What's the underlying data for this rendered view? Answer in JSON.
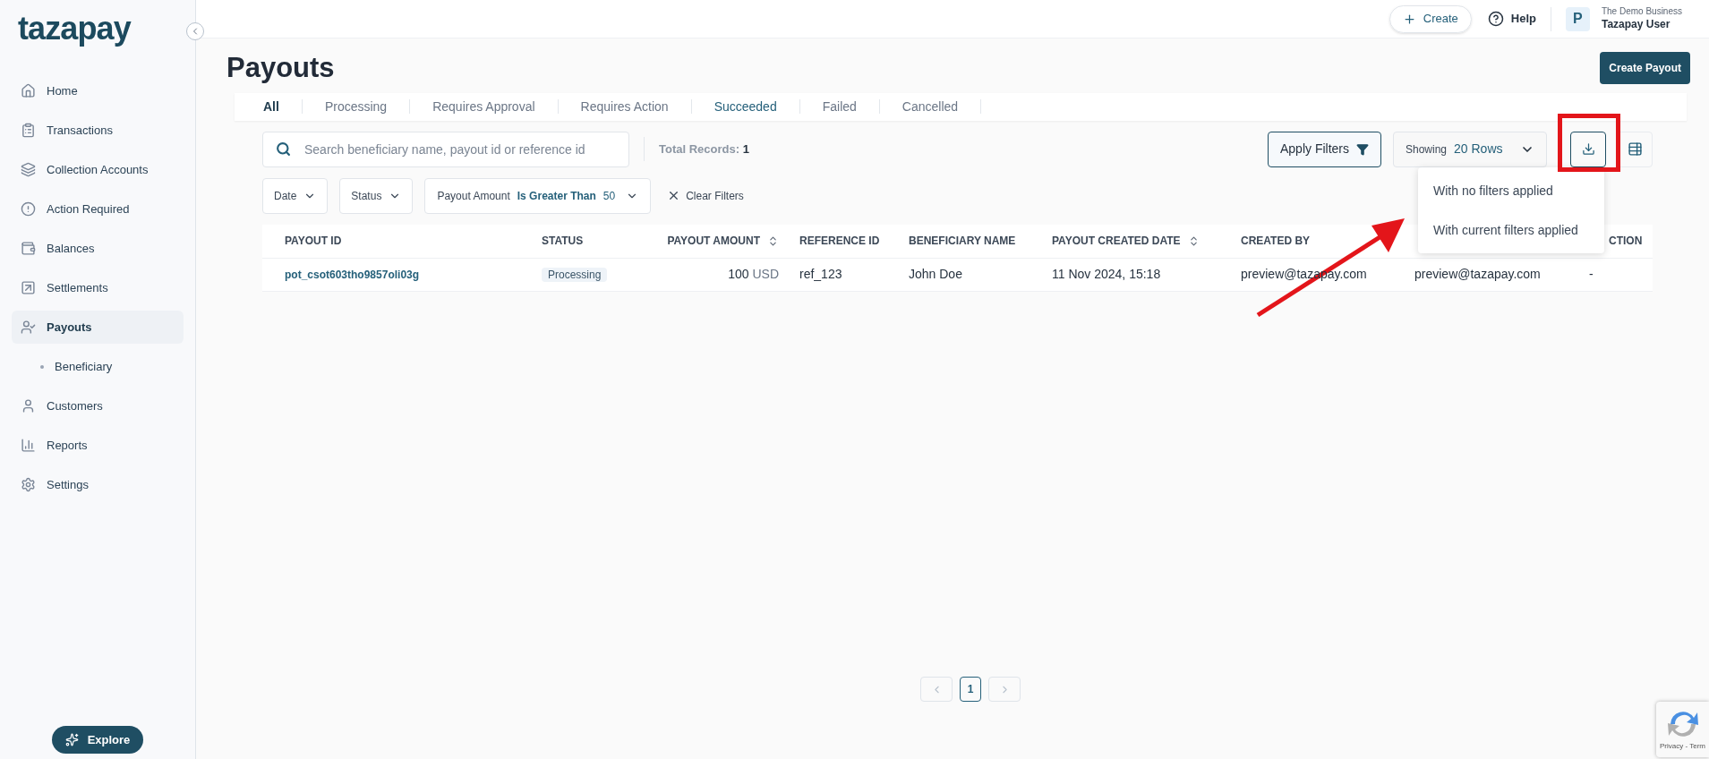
{
  "sidebar": {
    "logo": "tazapay",
    "items": [
      {
        "label": "Home",
        "selected": false
      },
      {
        "label": "Transactions",
        "selected": false
      },
      {
        "label": "Collection Accounts",
        "selected": false
      },
      {
        "label": "Action Required",
        "selected": false
      },
      {
        "label": "Balances",
        "selected": false
      },
      {
        "label": "Settlements",
        "selected": false
      },
      {
        "label": "Payouts",
        "selected": true,
        "children": [
          {
            "label": "Beneficiary",
            "selected": false
          }
        ]
      },
      {
        "label": "Customers",
        "selected": false
      },
      {
        "label": "Reports",
        "selected": false
      },
      {
        "label": "Settings",
        "selected": false
      }
    ],
    "explore": "Explore"
  },
  "header": {
    "create": "Create",
    "help": "Help",
    "avatar": "P",
    "business": "The Demo Business",
    "user": "Tazapay User"
  },
  "page": {
    "title": "Payouts",
    "create_button": "Create Payout"
  },
  "tabs": [
    {
      "label": "All",
      "selected": true,
      "hovered": false
    },
    {
      "label": "Processing",
      "selected": false,
      "hovered": false
    },
    {
      "label": "Requires Approval",
      "selected": false,
      "hovered": false
    },
    {
      "label": "Requires Action",
      "selected": false,
      "hovered": false
    },
    {
      "label": "Succeeded",
      "selected": false,
      "hovered": true
    },
    {
      "label": "Failed",
      "selected": false,
      "hovered": false
    },
    {
      "label": "Cancelled",
      "selected": false,
      "hovered": false
    }
  ],
  "search": {
    "placeholder": "Search beneficiary name, payout id or reference id"
  },
  "total_records": {
    "label": "Total Records:",
    "value": "1"
  },
  "apply_filters": "Apply Filters",
  "rows_select": {
    "label": "Showing",
    "value": "20 Rows"
  },
  "download_menu": {
    "open": true,
    "items": [
      "With no filters applied",
      "With current filters applied"
    ]
  },
  "filters": [
    {
      "kind": "simple",
      "label": "Date"
    },
    {
      "kind": "simple",
      "label": "Status"
    },
    {
      "kind": "condition",
      "label": "Payout Amount",
      "operator": "Is Greater Than",
      "value": "50"
    }
  ],
  "clear_filters": "Clear Filters",
  "table": {
    "columns": [
      {
        "label": "PAYOUT ID",
        "sortable": false
      },
      {
        "label": "STATUS",
        "sortable": false
      },
      {
        "label": "PAYOUT AMOUNT",
        "sortable": true
      },
      {
        "label": "REFERENCE ID",
        "sortable": false
      },
      {
        "label": "BENEFICIARY NAME",
        "sortable": false
      },
      {
        "label": "PAYOUT CREATED DATE",
        "sortable": true
      },
      {
        "label": "CREATED BY",
        "sortable": false
      },
      {},
      {
        "label": "CTION",
        "sortable": false
      }
    ],
    "rows": [
      {
        "payout_id": "pot_csot603tho9857oli03g",
        "status": "Processing",
        "amount": "100",
        "currency": "USD",
        "reference_id": "ref_123",
        "beneficiary_name": "John Doe",
        "created_date": "11 Nov 2024, 15:18",
        "created_by": "preview@tazapay.com",
        "column_8": "preview@tazapay.com",
        "action": "-"
      }
    ]
  },
  "pagination": {
    "pages": [
      {
        "label": "1",
        "selected": true
      }
    ]
  },
  "annotation": {
    "highlight": true,
    "arrow": true
  },
  "recaptcha": {
    "text": "Privacy - Term"
  }
}
